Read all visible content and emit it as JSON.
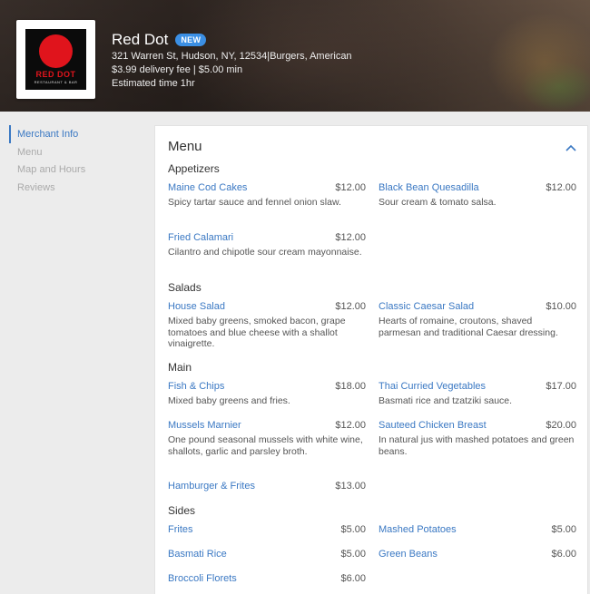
{
  "header": {
    "logo": {
      "name": "RED DOT",
      "sub": "RESTAURANT & BAR"
    },
    "title": "Red Dot",
    "badge": "NEW",
    "address": "321 Warren St, Hudson, NY, 12534|Burgers, American",
    "fees": "$3.99 delivery fee | $5.00 min",
    "eta": "Estimated time 1hr"
  },
  "sidebar": {
    "items": [
      {
        "label": "Merchant Info",
        "active": true
      },
      {
        "label": "Menu",
        "active": false
      },
      {
        "label": "Map and Hours",
        "active": false
      },
      {
        "label": "Reviews",
        "active": false
      }
    ]
  },
  "menu": {
    "title": "Menu",
    "sections": [
      {
        "title": "Appetizers",
        "items": [
          {
            "name": "Maine Cod Cakes",
            "price": "$12.00",
            "desc": "Spicy tartar sauce and fennel onion slaw."
          },
          {
            "name": "Black Bean Quesadilla",
            "price": "$12.00",
            "desc": "Sour cream & tomato salsa."
          },
          {
            "name": "Fried Calamari",
            "price": "$12.00",
            "desc": "Cilantro and chipotle sour cream mayonnaise."
          }
        ]
      },
      {
        "title": "Salads",
        "items": [
          {
            "name": "House Salad",
            "price": "$12.00",
            "desc": "Mixed baby greens, smoked bacon, grape tomatoes and blue cheese with a shallot vinaigrette."
          },
          {
            "name": "Classic Caesar Salad",
            "price": "$10.00",
            "desc": "Hearts of romaine, croutons, shaved parmesan and traditional Caesar dressing."
          }
        ]
      },
      {
        "title": "Main",
        "items": [
          {
            "name": "Fish & Chips",
            "price": "$18.00",
            "desc": "Mixed baby greens and fries."
          },
          {
            "name": "Thai Curried Vegetables",
            "price": "$17.00",
            "desc": "Basmati rice and tzatziki sauce."
          },
          {
            "name": "Mussels Marnier",
            "price": "$12.00",
            "desc": "One pound seasonal mussels with white wine, shallots, garlic and parsley broth."
          },
          {
            "name": "Sauteed Chicken Breast",
            "price": "$20.00",
            "desc": "In natural jus with mashed potatoes and green beans."
          },
          {
            "name": "Hamburger & Frites",
            "price": "$13.00",
            "desc": ""
          }
        ]
      },
      {
        "title": "Sides",
        "items": [
          {
            "name": "Frites",
            "price": "$5.00",
            "desc": ""
          },
          {
            "name": "Mashed Potatoes",
            "price": "$5.00",
            "desc": ""
          },
          {
            "name": "Basmati Rice",
            "price": "$5.00",
            "desc": ""
          },
          {
            "name": "Green Beans",
            "price": "$6.00",
            "desc": ""
          },
          {
            "name": "Broccoli Florets",
            "price": "$6.00",
            "desc": ""
          }
        ]
      }
    ]
  },
  "colors": {
    "accent": "#3a78c3",
    "badge": "#3b8fe4",
    "logo_red": "#e0141c"
  }
}
